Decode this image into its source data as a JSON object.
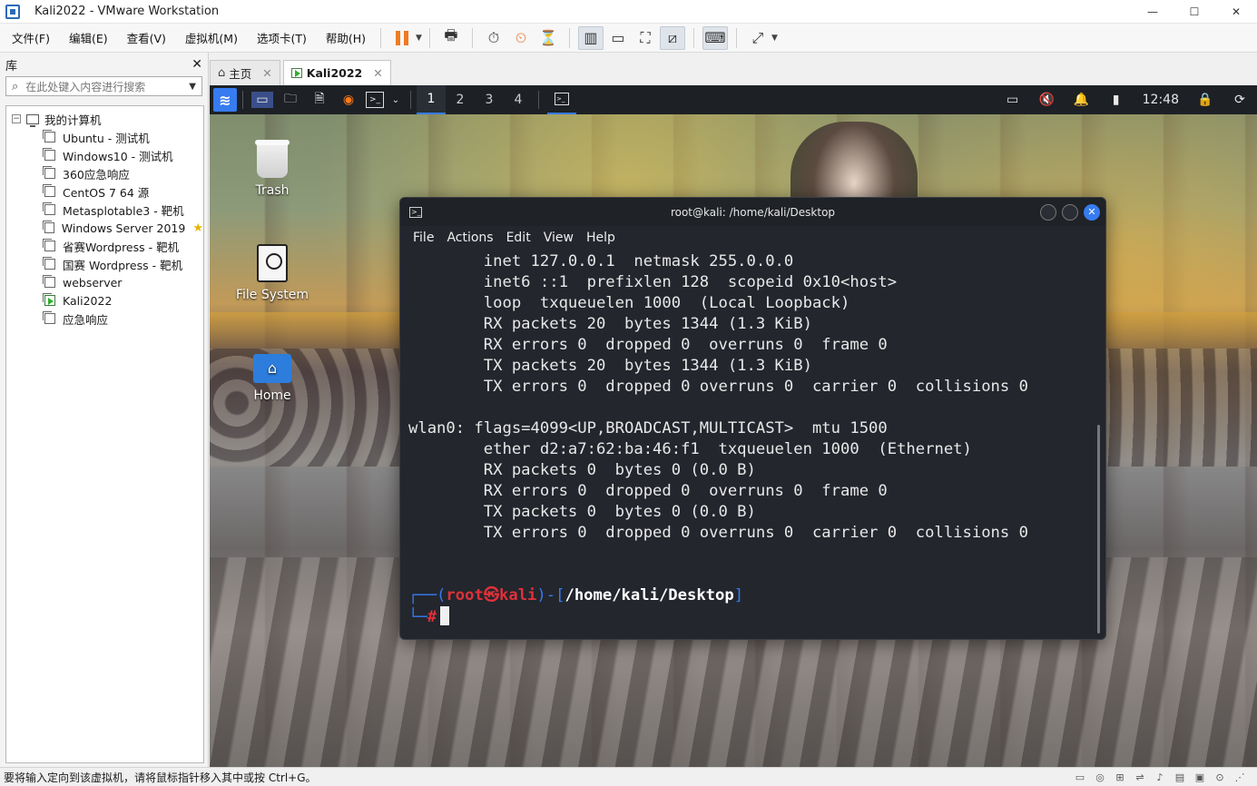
{
  "window": {
    "title": "Kali2022 - VMware Workstation",
    "minimize": "—",
    "maximize": "☐",
    "close": "✕"
  },
  "menubar": {
    "items": [
      "文件(F)",
      "编辑(E)",
      "查看(V)",
      "虚拟机(M)",
      "选项卡(T)",
      "帮助(H)"
    ]
  },
  "library": {
    "title": "库",
    "close": "✕",
    "search_placeholder": "在此处键入内容进行搜索",
    "root": "我的计算机",
    "vms": [
      {
        "name": "Ubuntu - 测试机",
        "state": "off"
      },
      {
        "name": "Windows10 - 测试机",
        "state": "off"
      },
      {
        "name": "360应急响应",
        "state": "off"
      },
      {
        "name": "CentOS 7 64 源",
        "state": "off"
      },
      {
        "name": "Metasplotable3 - 靶机",
        "state": "off"
      },
      {
        "name": "Windows Server 2019",
        "state": "off",
        "favorite": true
      },
      {
        "name": "省赛Wordpress - 靶机",
        "state": "off"
      },
      {
        "name": "国赛 Wordpress - 靶机",
        "state": "off"
      },
      {
        "name": "webserver",
        "state": "off"
      },
      {
        "name": "Kali2022",
        "state": "running"
      },
      {
        "name": "应急响应",
        "state": "off"
      }
    ]
  },
  "tabs": [
    {
      "label": "主页",
      "active": false,
      "close": "✕"
    },
    {
      "label": "Kali2022",
      "active": true,
      "close": "✕"
    }
  ],
  "kali_panel": {
    "workspaces": [
      "1",
      "2",
      "3",
      "4"
    ],
    "active_workspace": "1",
    "clock": "12:48"
  },
  "desktop_icons": [
    {
      "label": "Trash"
    },
    {
      "label": "File System"
    },
    {
      "label": "Home"
    }
  ],
  "terminal": {
    "title": "root@kali: /home/kali/Desktop",
    "menu": [
      "File",
      "Actions",
      "Edit",
      "View",
      "Help"
    ],
    "lines": [
      "        inet 127.0.0.1  netmask 255.0.0.0",
      "        inet6 ::1  prefixlen 128  scopeid 0x10<host>",
      "        loop  txqueuelen 1000  (Local Loopback)",
      "        RX packets 20  bytes 1344 (1.3 KiB)",
      "        RX errors 0  dropped 0  overruns 0  frame 0",
      "        TX packets 20  bytes 1344 (1.3 KiB)",
      "        TX errors 0  dropped 0 overruns 0  carrier 0  collisions 0",
      "",
      "wlan0: flags=4099<UP,BROADCAST,MULTICAST>  mtu 1500",
      "        ether d2:a7:62:ba:46:f1  txqueuelen 1000  (Ethernet)",
      "        RX packets 0  bytes 0 (0.0 B)",
      "        RX errors 0  dropped 0  overruns 0  frame 0",
      "        TX packets 0  bytes 0 (0.0 B)",
      "        TX errors 0  dropped 0 overruns 0  carrier 0  collisions 0",
      "",
      ""
    ],
    "prompt": {
      "open": "┌──(",
      "user": "root",
      "at": "㉿",
      "host": "kali",
      "mid": ")-[",
      "path": "/home/kali/Desktop",
      "close": "]",
      "line2": "└─",
      "hash": "#"
    }
  },
  "statusbar": {
    "message": "要将输入定向到该虚拟机，请将鼠标指针移入其中或按 Ctrl+G。"
  },
  "colors": {
    "kali_blue": "#367bf0",
    "prompt_red": "#e0303a",
    "pause_orange": "#f07a22"
  }
}
